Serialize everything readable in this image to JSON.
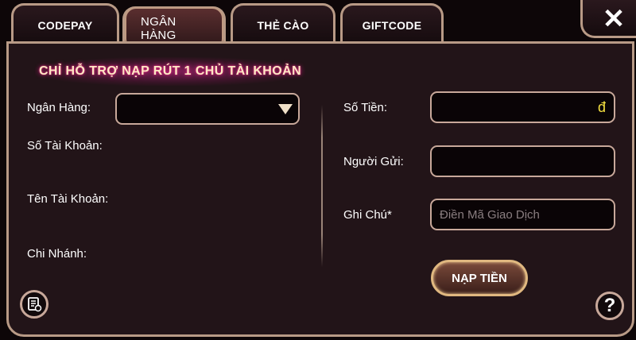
{
  "tabs": [
    {
      "label": "CODEPAY",
      "active": false
    },
    {
      "label": "NGÂN HÀNG",
      "active": true
    },
    {
      "label": "THẺ CÀO",
      "active": false
    },
    {
      "label": "GIFTCODE",
      "active": false
    }
  ],
  "close_label": "✕",
  "banner": "CHỈ HỖ TRỢ NẠP RÚT 1 CHỦ TÀI KHOẢN",
  "left": {
    "bank_label": "Ngân Hàng:",
    "bank_selected": "",
    "account_number_label": "Số Tài Khoản:",
    "account_name_label": "Tên Tài Khoản:",
    "branch_label": "Chi Nhánh:"
  },
  "right": {
    "amount_label": "Số Tiền:",
    "currency_symbol": "đ",
    "sender_label": "Người Gửi:",
    "note_label": "Ghi Chú*",
    "note_placeholder": "Điền Mã Giao Dịch"
  },
  "submit_label": "NẠP TIỀN",
  "help_label": "?",
  "icons": {
    "history": "history-icon",
    "help": "help-icon",
    "close": "close-icon",
    "dropdown": "dropdown-arrow-icon"
  },
  "colors": {
    "panel_bg": "#221418",
    "border": "#b89a86",
    "currency": "#f5e040",
    "banner_text": "#ffe9c4"
  }
}
